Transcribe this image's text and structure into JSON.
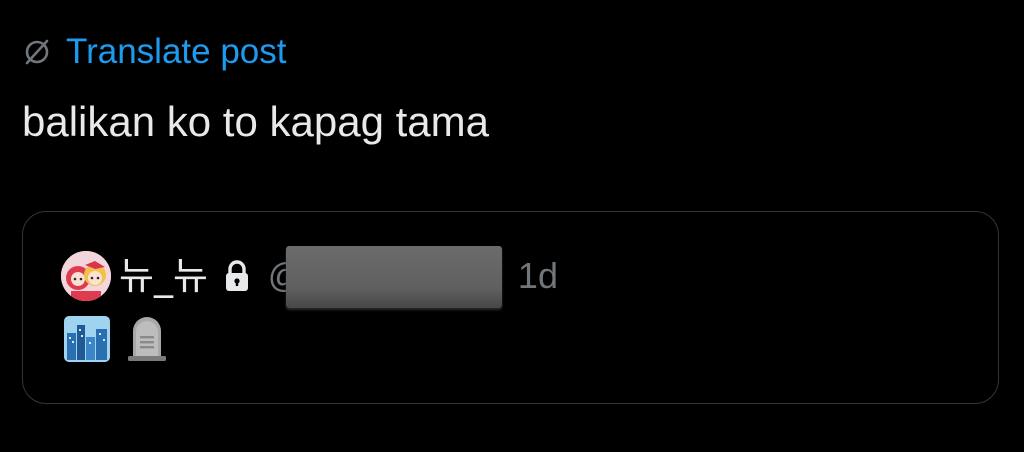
{
  "translate": {
    "label": "Translate post",
    "icon": "globe-slash-icon"
  },
  "post": {
    "text": "balikan ko to kapag tama"
  },
  "quoted_post": {
    "avatar_icon": "avatar-icon",
    "display_name": "뉴_뉴",
    "lock_icon": "lock-icon",
    "handle_prefix": "@",
    "handle_redacted": true,
    "timestamp": "1d",
    "emojis": [
      "cityscape-emoji",
      "headstone-emoji"
    ]
  },
  "colors": {
    "background": "#000000",
    "text_primary": "#e7e9ea",
    "text_secondary": "#71767b",
    "link": "#1d9bf0",
    "card_border": "#333639"
  }
}
